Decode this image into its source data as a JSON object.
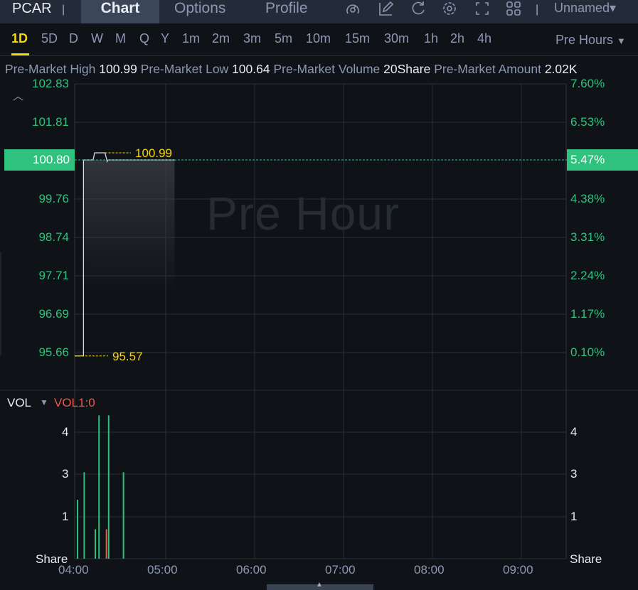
{
  "header": {
    "symbol": "PCAR",
    "tabs": [
      "Chart",
      "Options",
      "Profile"
    ],
    "active_tab": "Chart",
    "layout_name": "Unnamed",
    "icons": [
      "speedometer-icon",
      "edit-icon",
      "refresh-icon",
      "settings-icon",
      "fullscreen-icon",
      "layout-grid-icon"
    ]
  },
  "periods": {
    "items": [
      "1D",
      "5D",
      "D",
      "W",
      "M",
      "Q",
      "Y",
      "1m",
      "2m",
      "3m",
      "5m",
      "10m",
      "15m",
      "30m",
      "1h",
      "2h",
      "4h"
    ],
    "active": "1D",
    "session": "Pre Hours"
  },
  "stats": [
    {
      "label": "Pre-Market High",
      "value": "100.99"
    },
    {
      "label": "Pre-Market Low",
      "value": "100.64"
    },
    {
      "label": "Pre-Market Volume",
      "value": "20Share"
    },
    {
      "label": "Pre-Market Amount",
      "value": "2.02K"
    }
  ],
  "price_chart": {
    "watermark": "Pre Hour",
    "left_ticks": [
      "102.83",
      "101.81",
      "100.80",
      "99.76",
      "98.74",
      "97.71",
      "96.69",
      "95.66"
    ],
    "right_ticks": [
      "7.60%",
      "6.53%",
      "5.47%",
      "4.38%",
      "3.31%",
      "2.24%",
      "1.17%",
      "0.10%"
    ],
    "current_price": "100.80",
    "current_pct": "5.47%",
    "high_label": "100.99",
    "low_label": "95.57",
    "colors": {
      "up": "#2ec27e",
      "down": "#f0564a",
      "mark": "#f5d90a"
    }
  },
  "volume": {
    "title": "VOL",
    "indicator": "VOL1:0",
    "ticks": [
      "4",
      "3",
      "1"
    ],
    "unit": "Share"
  },
  "x_ticks": [
    "04:00",
    "05:00",
    "06:00",
    "07:00",
    "08:00",
    "09:00"
  ],
  "chart_data": {
    "type": "line",
    "price_range": [
      95.66,
      102.83
    ],
    "series": [
      {
        "name": "price",
        "points": [
          [
            -1.5,
            95.57
          ],
          [
            4.5,
            95.57
          ],
          [
            4.5,
            100.8
          ],
          [
            11,
            100.8
          ],
          [
            12,
            100.99
          ],
          [
            19,
            100.99
          ],
          [
            20.5,
            100.76
          ],
          [
            21,
            100.8
          ],
          [
            66,
            100.8
          ]
        ]
      }
    ],
    "volume_bars": [
      {
        "t": 0.5,
        "level": 1.4,
        "dir": "up"
      },
      {
        "t": 5,
        "level": 2.05,
        "dir": "up"
      },
      {
        "t": 12.5,
        "level": 0.7,
        "dir": "up"
      },
      {
        "t": 15,
        "level": 3.4,
        "dir": "up"
      },
      {
        "t": 20,
        "level": 0.7,
        "dir": "down"
      },
      {
        "t": 21.5,
        "level": 3.4,
        "dir": "up"
      },
      {
        "t": 31.5,
        "level": 2.05,
        "dir": "up"
      }
    ]
  }
}
